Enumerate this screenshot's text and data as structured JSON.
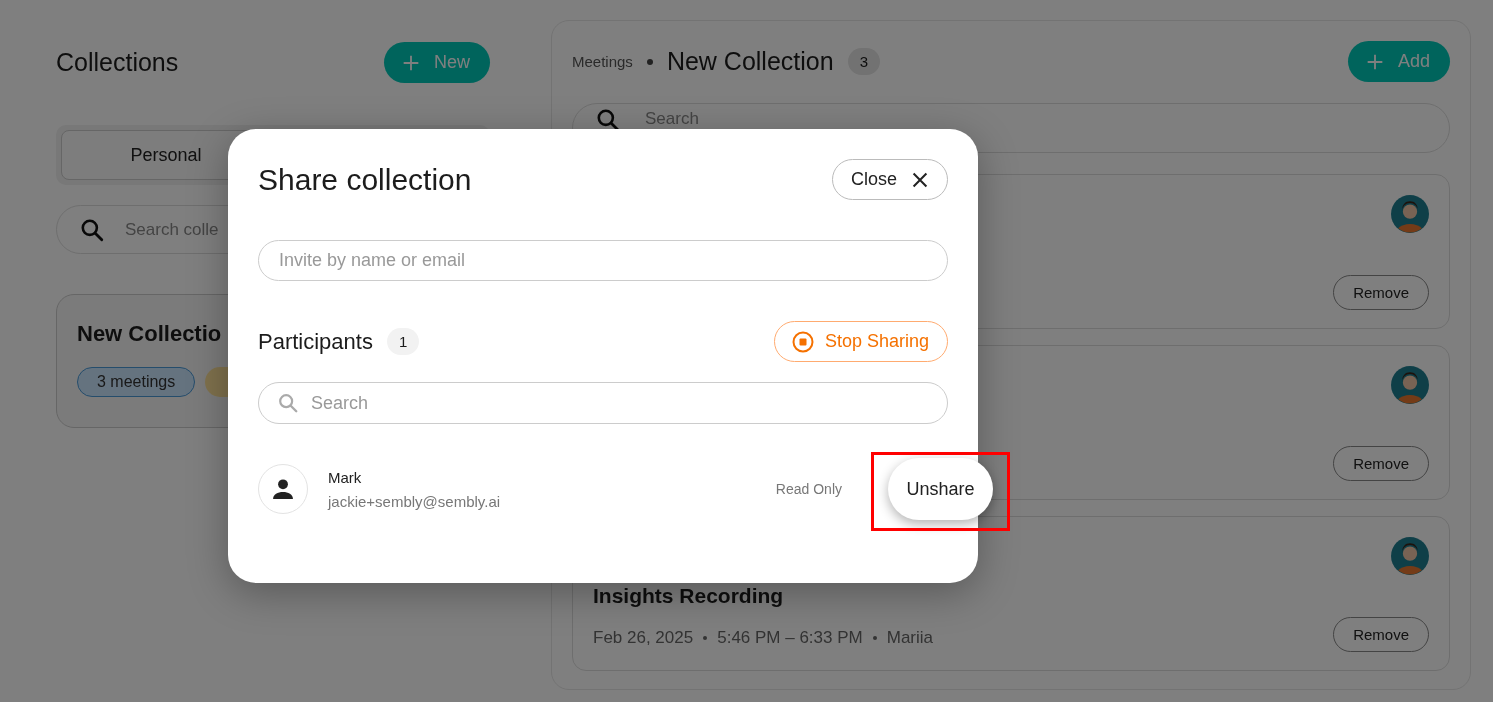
{
  "sidebar": {
    "title": "Collections",
    "new_button": "New",
    "tabs": [
      {
        "label": "Personal",
        "selected": true
      }
    ],
    "search": {
      "placeholder": "Search colle"
    },
    "collections": [
      {
        "title": "New Collectio",
        "tags": [
          "3 meetings"
        ]
      }
    ]
  },
  "main": {
    "breadcrumb": "Meetings",
    "title": "New Collection",
    "count": "3",
    "add_button": "Add",
    "search": {
      "placeholder": "Search"
    },
    "meetings": [
      {
        "remove_button": "Remove"
      },
      {
        "remove_button": "Remove"
      },
      {
        "title": "Insights Recording",
        "date": "Feb 26, 2025",
        "time": "5:46 PM – 6:33 PM",
        "owner": "Mariia",
        "remove_button": "Remove"
      }
    ]
  },
  "dialog": {
    "title": "Share collection",
    "close_button": "Close",
    "invite": {
      "placeholder": "Invite by name or email"
    },
    "participants_heading": "Participants",
    "participants_count": "1",
    "stop_sharing_button": "Stop Sharing",
    "search": {
      "placeholder": "Search"
    },
    "participants": [
      {
        "name": "Mark",
        "email": "jackie+sembly@sembly.ai",
        "role": "Read Only",
        "menu_action": "Unshare",
        "highlighted": true
      }
    ]
  }
}
